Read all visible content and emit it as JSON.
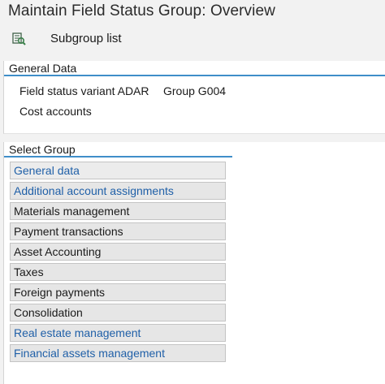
{
  "window": {
    "title": "Maintain Field Status Group: Overview"
  },
  "toolbar": {
    "subgroup_icon": "subgroup-list-icon",
    "subgroup_label": "Subgroup list"
  },
  "general_data": {
    "header": "General Data",
    "field_status_variant": "Field status variant ADAR",
    "group": "Group G004",
    "description": "Cost accounts"
  },
  "select_group": {
    "header": "Select Group",
    "items": [
      {
        "label": "General data",
        "style": "link",
        "focused": true
      },
      {
        "label": "Additional account assignments",
        "style": "link"
      },
      {
        "label": "Materials management",
        "style": "plain"
      },
      {
        "label": "Payment transactions",
        "style": "plain"
      },
      {
        "label": "Asset Accounting",
        "style": "plain"
      },
      {
        "label": "Taxes",
        "style": "plain"
      },
      {
        "label": "Foreign payments",
        "style": "plain"
      },
      {
        "label": "Consolidation",
        "style": "plain"
      },
      {
        "label": "Real estate management",
        "style": "link"
      },
      {
        "label": "Financial assets management",
        "style": "link"
      }
    ]
  },
  "colors": {
    "link_text": "#2060a8",
    "header_underline": "#3f8ec9",
    "focus_corner": "#d9442a"
  }
}
